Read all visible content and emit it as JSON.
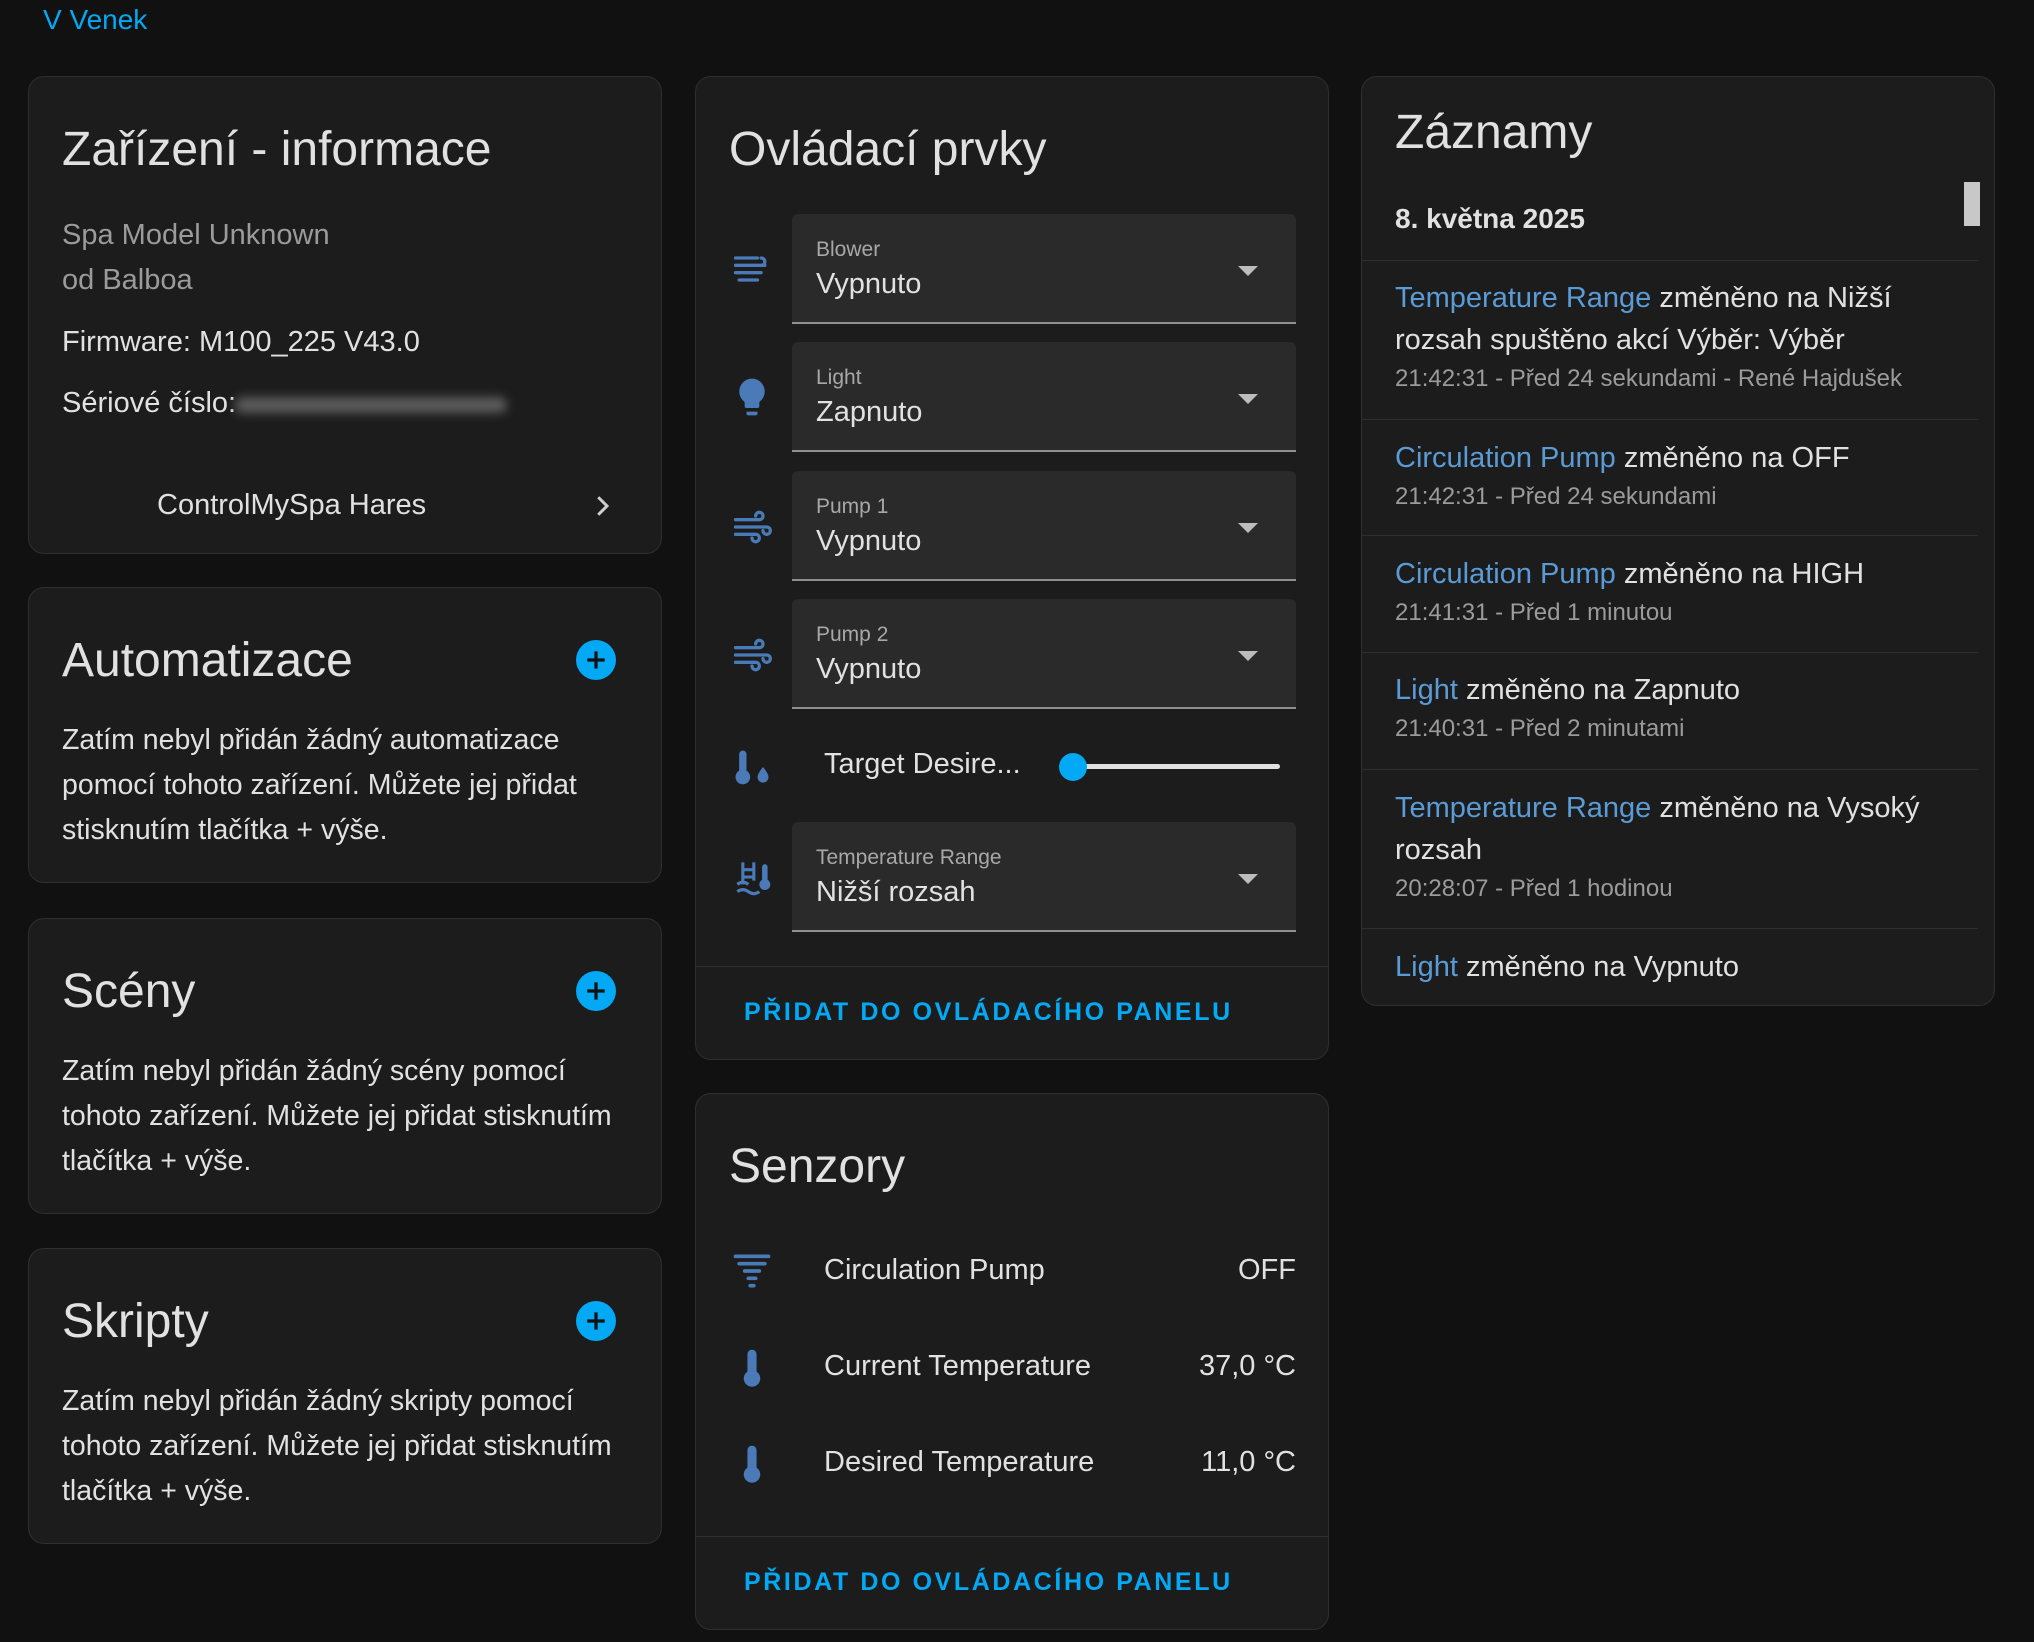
{
  "area_link": "V Venek",
  "device_info": {
    "title": "Zařízení - informace",
    "model": "Spa Model Unknown",
    "manufacturer": "od Balboa",
    "firmware": "Firmware: M100_225 V43.0",
    "serial_label": "Sériové číslo:",
    "link_label": "ControlMySpa Hares"
  },
  "automations": {
    "title": "Automatizace",
    "text": "Zatím nebyl přidán žádný automatizace pomocí tohoto zařízení. Můžete jej přidat stisknutím tlačítka + výše."
  },
  "scenes": {
    "title": "Scény",
    "text": "Zatím nebyl přidán žádný scény pomocí tohoto zařízení. Můžete jej přidat stisknutím tlačítka + výše."
  },
  "scripts": {
    "title": "Skripty",
    "text": "Zatím nebyl přidán žádný skripty pomocí tohoto zařízení. Můžete jej přidat stisknutím tlačítka + výše."
  },
  "controls": {
    "title": "Ovládací prvky",
    "items": [
      {
        "label": "Blower",
        "value": "Vypnuto",
        "icon": "fan-icon"
      },
      {
        "label": "Light",
        "value": "Zapnuto",
        "icon": "lightbulb-icon"
      },
      {
        "label": "Pump 1",
        "value": "Vypnuto",
        "icon": "pump-icon"
      },
      {
        "label": "Pump 2",
        "value": "Vypnuto",
        "icon": "pump-icon"
      }
    ],
    "slider": {
      "label": "Target Desire...",
      "value_fraction": 0.0,
      "icon": "thermometer-water-icon"
    },
    "range": {
      "label": "Temperature Range",
      "value": "Nižší rozsah",
      "icon": "pool-thermometer-icon"
    },
    "add_button": "PŘIDAT DO OVLÁDACÍHO PANELU"
  },
  "sensors": {
    "title": "Senzory",
    "items": [
      {
        "name": "Circulation Pump",
        "value": "OFF",
        "icon": "filter-icon"
      },
      {
        "name": "Current Temperature",
        "value": "37,0 °C",
        "icon": "thermometer-icon"
      },
      {
        "name": "Desired Temperature",
        "value": "11,0 °C",
        "icon": "thermometer-icon"
      }
    ],
    "add_button": "PŘIDAT DO OVLÁDACÍHO PANELU"
  },
  "logbook": {
    "title": "Záznamy",
    "date": "8. května 2025",
    "entries": [
      {
        "entity": "Temperature Range",
        "message": " změněno na Nižší rozsah spuštěno akcí Výběr: Výběr",
        "time": "21:42:31 - Před 24 sekundami - René Hajdušek"
      },
      {
        "entity": "Circulation Pump",
        "message": " změněno na OFF",
        "time": "21:42:31 - Před 24 sekundami"
      },
      {
        "entity": "Circulation Pump",
        "message": " změněno na HIGH",
        "time": "21:41:31 - Před 1 minutou"
      },
      {
        "entity": "Light",
        "message": " změněno na Zapnuto",
        "time": "21:40:31 - Před 2 minutami"
      },
      {
        "entity": "Temperature Range",
        "message": " změněno na Vysoký rozsah",
        "time": "20:28:07 - Před 1 hodinou"
      },
      {
        "entity": "Light",
        "message": " změněno na Vypnuto",
        "time": ""
      }
    ]
  },
  "colors": {
    "accent": "#03a9f4",
    "entity_link": "#5b9bd5",
    "icon": "#4a7ab8",
    "card_bg": "#1c1c1c",
    "page_bg": "#111111"
  }
}
